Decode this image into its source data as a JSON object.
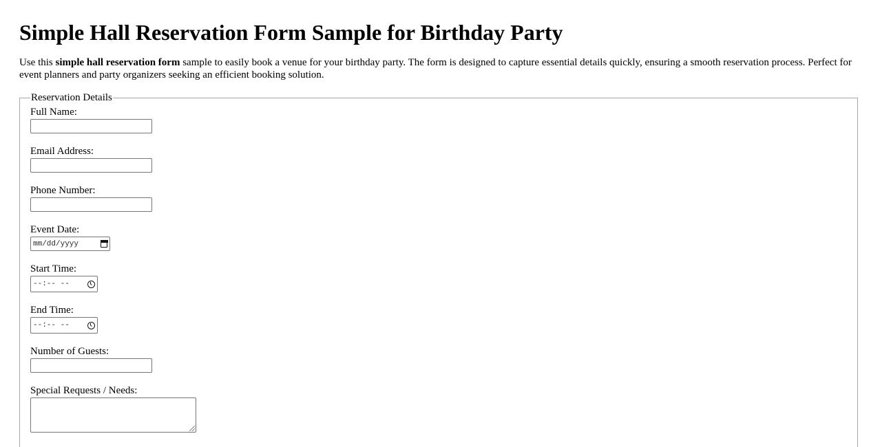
{
  "page": {
    "title": "Simple Hall Reservation Form Sample for Birthday Party",
    "intro": {
      "prefix": "Use this ",
      "bold": "simple hall reservation form",
      "suffix": " sample to easily book a venue for your birthday party. The form is designed to capture essential details quickly, ensuring a smooth reservation process. Perfect for event planners and party organizers seeking an efficient booking solution."
    }
  },
  "form": {
    "legend": "Reservation Details",
    "fields": {
      "full_name": {
        "label": "Full Name:",
        "value": ""
      },
      "email": {
        "label": "Email Address:",
        "value": ""
      },
      "phone": {
        "label": "Phone Number:",
        "value": ""
      },
      "event_date": {
        "label": "Event Date:",
        "placeholder": "mm/dd/yyyy",
        "icon": "calendar-icon"
      },
      "start_time": {
        "label": "Start Time:",
        "placeholder": "--:-- --",
        "icon": "clock-icon"
      },
      "end_time": {
        "label": "End Time:",
        "placeholder": "--:-- --",
        "icon": "clock-icon"
      },
      "guests": {
        "label": "Number of Guests:",
        "value": ""
      },
      "special_requests": {
        "label": "Special Requests / Needs:",
        "value": ""
      }
    }
  }
}
